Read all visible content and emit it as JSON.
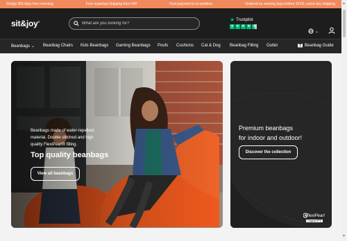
{
  "topbar": {
    "messages": [
      "Simply 365 days free returning",
      "Free superfast shipping from €40",
      "Fast payment is no problem",
      "Ordered on working days before 16:00, same day shipping"
    ]
  },
  "header": {
    "logo": "sit&joy",
    "logo_mark": "®",
    "search_placeholder": "What are you looking for?",
    "trustpilot": "Trustpilot",
    "trustpilot_rating_stars": 4.5,
    "language_icon": "globe-icon",
    "account_icon": "user-icon"
  },
  "nav": {
    "items": [
      "Beanbags",
      "Beanbag Chairs",
      "Kids Beanbags",
      "Gaming Beanbags",
      "Poufs",
      "Cushions",
      "Cat & Dog",
      "Beanbag Filling",
      "Outlet"
    ],
    "guide": "Beanbag Guide"
  },
  "hero": {
    "copy_line1": "Beanbags made of water-repellent",
    "copy_line2": "material. Double stitched and high",
    "copy_line3": "quality FlexiPearl® filling.",
    "title": "Top quality beanbags",
    "button": "View all beanbags"
  },
  "promo": {
    "title_line1": "Premium beanbags",
    "title_line2": "for indoor and outdoor!",
    "button": "Discover the collection",
    "badge_name": "FlexiPearl",
    "badge_sub": "Original EPS"
  },
  "colors": {
    "topbar": "#f08a5d",
    "header": "#1d1d1d",
    "nav": "#262626",
    "trustpilot_green": "#00b67a",
    "beanbag_orange": "#f05a1e"
  }
}
